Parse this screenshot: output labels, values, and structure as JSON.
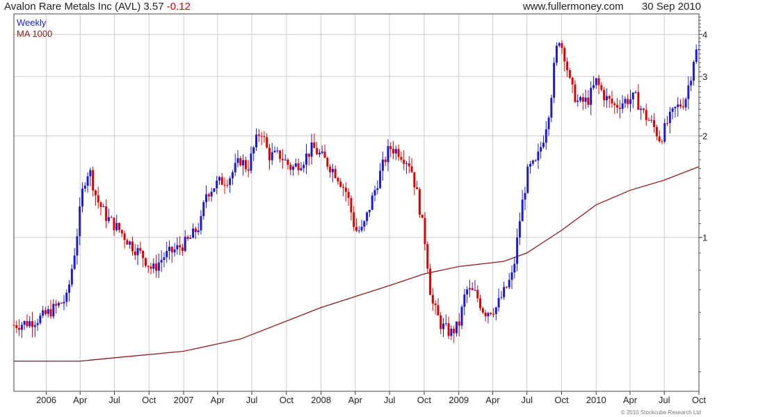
{
  "header": {
    "title": "Avalon Rare Metals Inc (AVL)",
    "last": "3.57",
    "change": "-0.12",
    "site": "www.fullermoney.com",
    "date": "30 Sep 2010"
  },
  "legend": {
    "weekly": "Weekly",
    "ma": "MA 1000"
  },
  "copyright": "© 2010 Stockcube Research Ltd",
  "colors": {
    "up": "#1a1ad6",
    "down": "#e00000",
    "ma": "#8b1a1a",
    "grid": "#cccccc"
  },
  "chart_data": {
    "type": "candlestick",
    "title": "Avalon Rare Metals Inc (AVL)",
    "y_scale": "log",
    "ylim": [
      0.35,
      4.6
    ],
    "y_ticks": [
      1,
      2,
      3,
      4
    ],
    "x_ticks": [
      {
        "date": "2006-01-01",
        "label": "2006"
      },
      {
        "date": "2006-04-01",
        "label": "Apr"
      },
      {
        "date": "2006-07-01",
        "label": "Jul"
      },
      {
        "date": "2006-10-01",
        "label": "Oct"
      },
      {
        "date": "2007-01-01",
        "label": "2007"
      },
      {
        "date": "2007-04-01",
        "label": "Apr"
      },
      {
        "date": "2007-07-01",
        "label": "Jul"
      },
      {
        "date": "2007-10-01",
        "label": "Oct"
      },
      {
        "date": "2008-01-01",
        "label": "2008"
      },
      {
        "date": "2008-04-01",
        "label": "Apr"
      },
      {
        "date": "2008-07-01",
        "label": "Jul"
      },
      {
        "date": "2008-10-01",
        "label": "Oct"
      },
      {
        "date": "2009-01-01",
        "label": "2009"
      },
      {
        "date": "2009-04-01",
        "label": "Apr"
      },
      {
        "date": "2009-07-01",
        "label": "Jul"
      },
      {
        "date": "2009-10-01",
        "label": "Oct"
      },
      {
        "date": "2010-01-01",
        "label": "2010"
      },
      {
        "date": "2010-04-01",
        "label": "Apr"
      },
      {
        "date": "2010-07-01",
        "label": "Jul"
      },
      {
        "date": "2010-10-01",
        "label": "Oct"
      }
    ],
    "price_path": [
      [
        "2005-10-07",
        0.55
      ],
      [
        "2005-11-15",
        0.56
      ],
      [
        "2005-12-20",
        0.58
      ],
      [
        "2006-01-25",
        0.62
      ],
      [
        "2006-02-25",
        0.66
      ],
      [
        "2006-03-20",
        0.95
      ],
      [
        "2006-04-10",
        1.45
      ],
      [
        "2006-04-25",
        1.6
      ],
      [
        "2006-05-15",
        1.3
      ],
      [
        "2006-06-10",
        1.15
      ],
      [
        "2006-07-15",
        1.05
      ],
      [
        "2006-08-15",
        0.95
      ],
      [
        "2006-09-15",
        0.88
      ],
      [
        "2006-10-10",
        0.8
      ],
      [
        "2006-11-10",
        0.88
      ],
      [
        "2006-12-10",
        0.92
      ],
      [
        "2007-01-15",
        0.98
      ],
      [
        "2007-02-15",
        1.1
      ],
      [
        "2007-03-01",
        1.35
      ],
      [
        "2007-04-01",
        1.45
      ],
      [
        "2007-05-01",
        1.5
      ],
      [
        "2007-06-01",
        1.7
      ],
      [
        "2007-06-20",
        1.6
      ],
      [
        "2007-07-10",
        1.9
      ],
      [
        "2007-07-25",
        2.1
      ],
      [
        "2007-08-15",
        1.75
      ],
      [
        "2007-09-15",
        1.75
      ],
      [
        "2007-10-15",
        1.6
      ],
      [
        "2007-11-15",
        1.7
      ],
      [
        "2007-12-10",
        1.85
      ],
      [
        "2008-01-10",
        1.7
      ],
      [
        "2008-02-10",
        1.55
      ],
      [
        "2008-03-10",
        1.35
      ],
      [
        "2008-04-01",
        1.05
      ],
      [
        "2008-04-20",
        1.05
      ],
      [
        "2008-05-20",
        1.35
      ],
      [
        "2008-06-10",
        1.6
      ],
      [
        "2008-07-01",
        1.85
      ],
      [
        "2008-07-25",
        1.8
      ],
      [
        "2008-08-25",
        1.65
      ],
      [
        "2008-09-15",
        1.3
      ],
      [
        "2008-10-05",
        0.95
      ],
      [
        "2008-10-20",
        0.65
      ],
      [
        "2008-11-15",
        0.55
      ],
      [
        "2008-12-10",
        0.52
      ],
      [
        "2009-01-01",
        0.55
      ],
      [
        "2009-01-20",
        0.7
      ],
      [
        "2009-02-15",
        0.68
      ],
      [
        "2009-03-10",
        0.6
      ],
      [
        "2009-04-10",
        0.62
      ],
      [
        "2009-05-10",
        0.72
      ],
      [
        "2009-05-25",
        0.78
      ],
      [
        "2009-06-15",
        1.2
      ],
      [
        "2009-07-05",
        1.6
      ],
      [
        "2009-07-25",
        1.65
      ],
      [
        "2009-08-15",
        2.0
      ],
      [
        "2009-09-01",
        2.5
      ],
      [
        "2009-09-15",
        3.5
      ],
      [
        "2009-09-25",
        3.9
      ],
      [
        "2009-10-10",
        3.45
      ],
      [
        "2009-10-25",
        2.8
      ],
      [
        "2009-11-15",
        2.5
      ],
      [
        "2009-12-10",
        2.55
      ],
      [
        "2010-01-01",
        2.9
      ],
      [
        "2010-01-25",
        2.6
      ],
      [
        "2010-02-20",
        2.45
      ],
      [
        "2010-03-20",
        2.55
      ],
      [
        "2010-04-15",
        2.6
      ],
      [
        "2010-05-10",
        2.3
      ],
      [
        "2010-06-01",
        2.15
      ],
      [
        "2010-06-20",
        1.95
      ],
      [
        "2010-07-10",
        2.2
      ],
      [
        "2010-07-30",
        2.4
      ],
      [
        "2010-08-25",
        2.55
      ],
      [
        "2010-09-10",
        3.05
      ],
      [
        "2010-09-20",
        3.55
      ],
      [
        "2010-09-30",
        3.57
      ]
    ],
    "ma_path": [
      [
        "2005-10-07",
        0.43
      ],
      [
        "2006-04-01",
        0.43
      ],
      [
        "2006-07-01",
        0.44
      ],
      [
        "2007-01-01",
        0.46
      ],
      [
        "2007-06-01",
        0.5
      ],
      [
        "2008-01-01",
        0.62
      ],
      [
        "2008-07-01",
        0.72
      ],
      [
        "2008-10-01",
        0.78
      ],
      [
        "2009-01-01",
        0.82
      ],
      [
        "2009-05-01",
        0.85
      ],
      [
        "2009-07-01",
        0.9
      ],
      [
        "2009-10-01",
        1.05
      ],
      [
        "2010-01-01",
        1.25
      ],
      [
        "2010-04-01",
        1.38
      ],
      [
        "2010-07-01",
        1.48
      ],
      [
        "2010-09-30",
        1.62
      ]
    ]
  }
}
